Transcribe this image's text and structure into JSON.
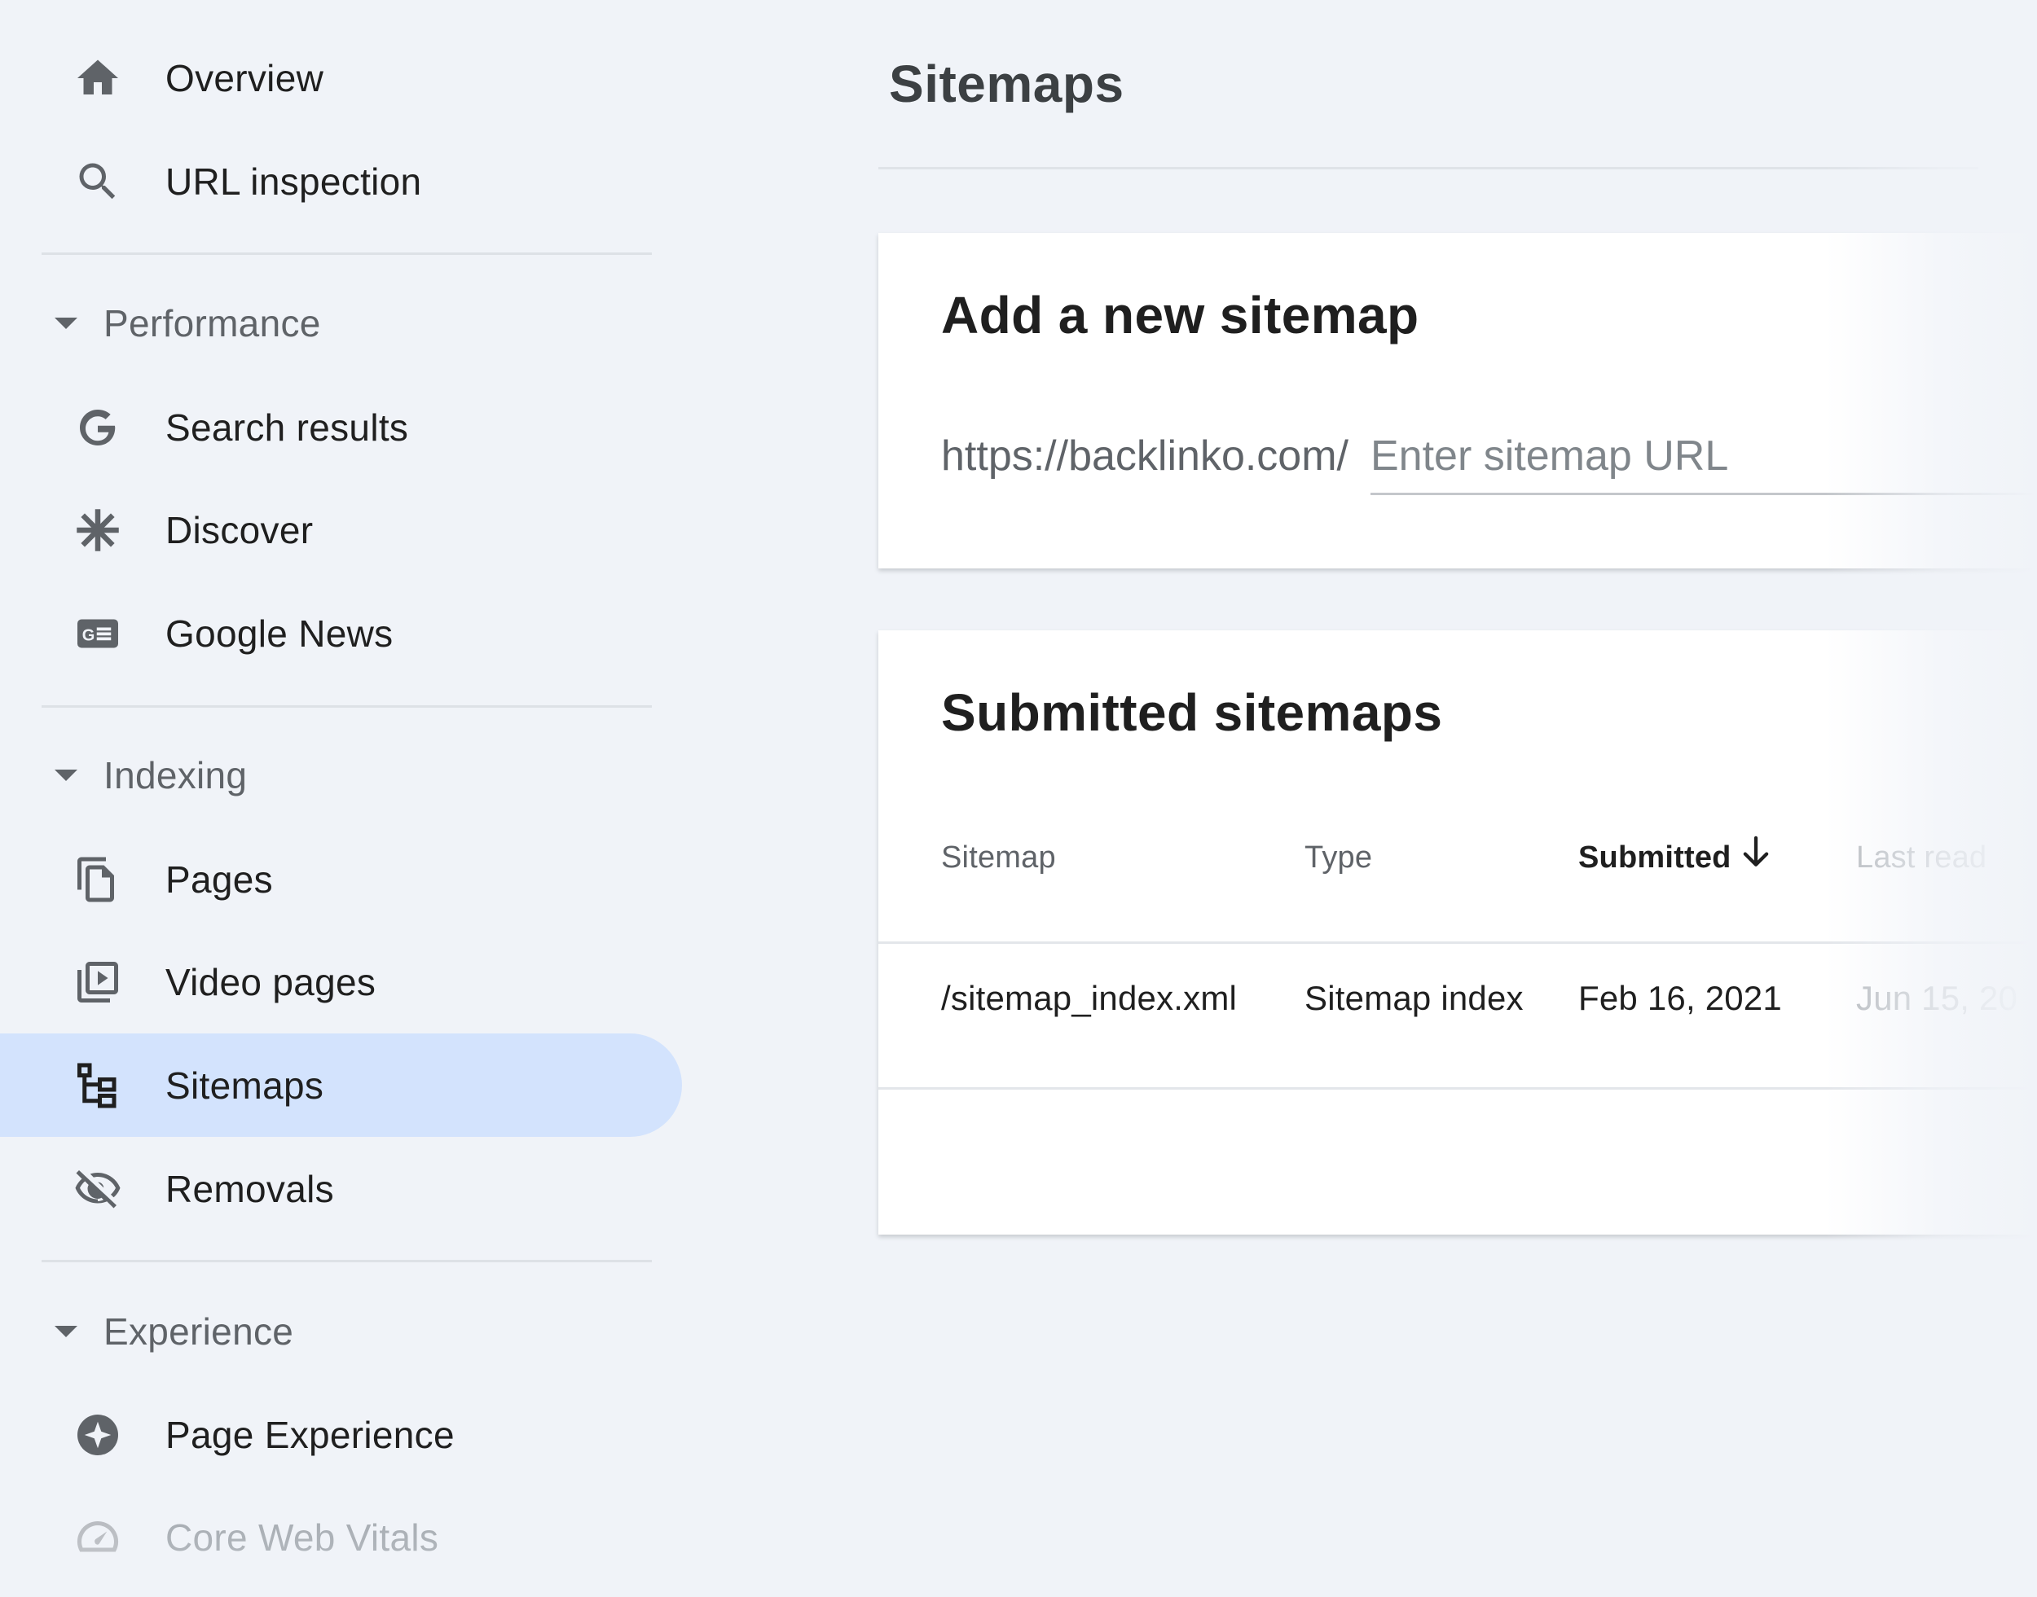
{
  "sidebar": {
    "overview": "Overview",
    "url_inspection": "URL inspection",
    "performance": {
      "heading": "Performance",
      "search_results": "Search results",
      "discover": "Discover",
      "google_news": "Google News"
    },
    "indexing": {
      "heading": "Indexing",
      "pages": "Pages",
      "video_pages": "Video pages",
      "sitemaps": "Sitemaps",
      "removals": "Removals"
    },
    "experience": {
      "heading": "Experience",
      "page_experience": "Page Experience",
      "core_web_vitals": "Core Web Vitals"
    },
    "active_item": "Sitemaps"
  },
  "main": {
    "title": "Sitemaps",
    "add_card": {
      "title": "Add a new sitemap",
      "url_prefix": "https://backlinko.com/",
      "input_value": "",
      "input_placeholder": "Enter sitemap URL"
    },
    "submitted_card": {
      "title": "Submitted sitemaps",
      "columns": [
        "Sitemap",
        "Type",
        "Submitted",
        "Last read"
      ],
      "sorted_column": "Submitted",
      "sort_direction": "descending",
      "rows": [
        {
          "sitemap": "/sitemap_index.xml",
          "type": "Sitemap index",
          "submitted": "Feb 16, 2021",
          "last_read": "Jun 15, 20"
        }
      ]
    }
  },
  "colors": {
    "background": "#f0f3f8",
    "active_nav": "#d3e3fd",
    "card": "#ffffff",
    "text_primary": "#1f1f1f",
    "text_secondary": "#5f6368"
  }
}
